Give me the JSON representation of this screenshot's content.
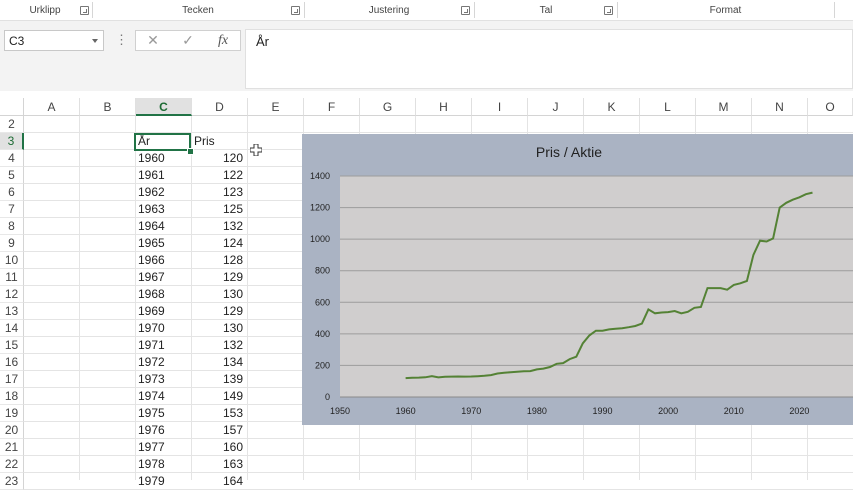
{
  "ribbon": {
    "groups": [
      {
        "label": "Urklipp"
      },
      {
        "label": "Tecken"
      },
      {
        "label": "Justering"
      },
      {
        "label": "Tal"
      },
      {
        "label": "Format"
      }
    ]
  },
  "formula_bar": {
    "name_box": "C3",
    "more_icon": "⋮",
    "cancel_icon": "✕",
    "enter_icon": "✓",
    "fx_label": "fx",
    "content": "År"
  },
  "sheet": {
    "columns": [
      "A",
      "B",
      "C",
      "D",
      "E",
      "F",
      "G",
      "H",
      "I",
      "J",
      "K",
      "L",
      "M",
      "N",
      "O"
    ],
    "selected_column": "C",
    "rows": [
      "2",
      "3",
      "4",
      "5",
      "6",
      "7",
      "8",
      "9",
      "10",
      "11",
      "12",
      "13",
      "14",
      "15",
      "16",
      "17",
      "18",
      "19",
      "20",
      "21",
      "22",
      "23"
    ],
    "selected_row": "3",
    "header_year": "År",
    "header_price": "Pris",
    "table": [
      {
        "year": "1960",
        "price": "120"
      },
      {
        "year": "1961",
        "price": "122"
      },
      {
        "year": "1962",
        "price": "123"
      },
      {
        "year": "1963",
        "price": "125"
      },
      {
        "year": "1964",
        "price": "132"
      },
      {
        "year": "1965",
        "price": "124"
      },
      {
        "year": "1966",
        "price": "128"
      },
      {
        "year": "1967",
        "price": "129"
      },
      {
        "year": "1968",
        "price": "130"
      },
      {
        "year": "1969",
        "price": "129"
      },
      {
        "year": "1970",
        "price": "130"
      },
      {
        "year": "1971",
        "price": "132"
      },
      {
        "year": "1972",
        "price": "134"
      },
      {
        "year": "1973",
        "price": "139"
      },
      {
        "year": "1974",
        "price": "149"
      },
      {
        "year": "1975",
        "price": "153"
      },
      {
        "year": "1976",
        "price": "157"
      },
      {
        "year": "1977",
        "price": "160"
      },
      {
        "year": "1978",
        "price": "163"
      },
      {
        "year": "1979",
        "price": "164"
      }
    ]
  },
  "chart_data": {
    "type": "line",
    "title": "Pris / Aktie",
    "xlabel": "",
    "ylabel": "",
    "xlim": [
      1950,
      2030
    ],
    "ylim": [
      0,
      1400
    ],
    "xticks": [
      "1950",
      "1960",
      "1970",
      "1980",
      "1990",
      "2000",
      "2010",
      "2020"
    ],
    "yticks": [
      "0",
      "200",
      "400",
      "600",
      "800",
      "1000",
      "1200",
      "1400"
    ],
    "grid": "horizontal",
    "line_color": "#548235",
    "plot_bg": "#d0cece",
    "chart_bg": "#aab3c3",
    "series": [
      {
        "x": [
          1960,
          1961,
          1962,
          1963,
          1964,
          1965,
          1966,
          1967,
          1968,
          1969,
          1970,
          1971,
          1972,
          1973,
          1974,
          1975,
          1976,
          1977,
          1978,
          1979,
          1980,
          1981,
          1982,
          1983,
          1984,
          1985,
          1986,
          1987,
          1988,
          1989,
          1990,
          1991,
          1992,
          1993,
          1994,
          1995,
          1996,
          1997,
          1998,
          1999,
          2000,
          2001,
          2002,
          2003,
          2004,
          2005,
          2006,
          2007,
          2008,
          2009,
          2010,
          2011,
          2012,
          2013,
          2014,
          2015,
          2016,
          2017,
          2018,
          2019,
          2020,
          2021,
          2022
        ],
        "values": [
          120,
          122,
          123,
          125,
          132,
          124,
          128,
          129,
          130,
          129,
          130,
          132,
          134,
          139,
          149,
          153,
          157,
          160,
          163,
          164,
          175,
          180,
          190,
          210,
          215,
          240,
          255,
          340,
          390,
          420,
          420,
          428,
          432,
          436,
          442,
          450,
          465,
          555,
          530,
          535,
          538,
          545,
          530,
          540,
          565,
          570,
          690,
          690,
          690,
          680,
          710,
          720,
          735,
          900,
          990,
          985,
          1005,
          1200,
          1230,
          1250,
          1265,
          1285,
          1295
        ]
      }
    ]
  },
  "colors": {
    "accent": "#217346",
    "line": "#548235"
  }
}
